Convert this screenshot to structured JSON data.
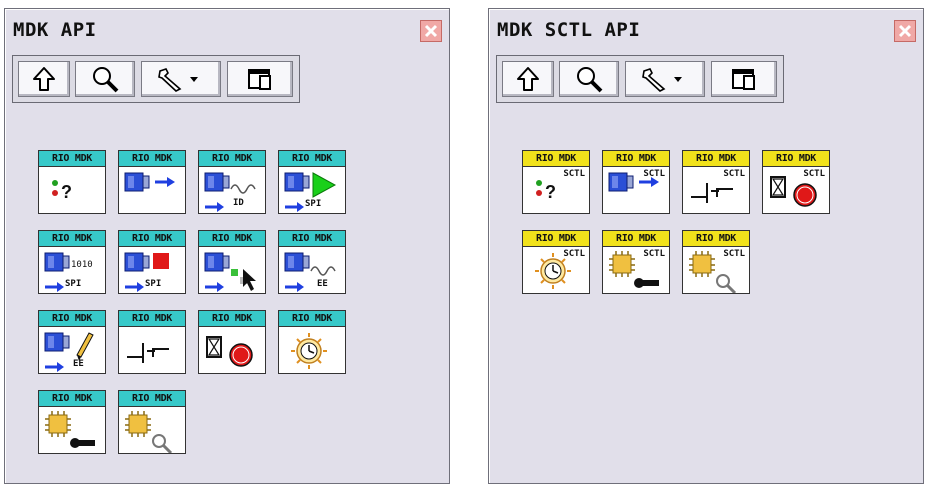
{
  "palettes": [
    {
      "title": "MDK API",
      "icons": [
        {
          "header": "RIO MDK",
          "header_color": "cyan",
          "glyph": "query-icon",
          "sub": ""
        },
        {
          "header": "RIO MDK",
          "header_color": "cyan",
          "glyph": "open-icon",
          "sub": ""
        },
        {
          "header": "RIO MDK",
          "header_color": "cyan",
          "glyph": "read-id-icon",
          "sub": "ID"
        },
        {
          "header": "RIO MDK",
          "header_color": "cyan",
          "glyph": "spi-run-icon",
          "sub": "SPI"
        },
        {
          "header": "RIO MDK",
          "header_color": "cyan",
          "glyph": "spi-data-icon",
          "sub": "SPI"
        },
        {
          "header": "RIO MDK",
          "header_color": "cyan",
          "glyph": "spi-stop-icon",
          "sub": "SPI"
        },
        {
          "header": "RIO MDK",
          "header_color": "cyan",
          "glyph": "select-icon",
          "sub": ""
        },
        {
          "header": "RIO MDK",
          "header_color": "cyan",
          "glyph": "ee-wave-icon",
          "sub": "EE"
        },
        {
          "header": "RIO MDK",
          "header_color": "cyan",
          "glyph": "ee-write-icon",
          "sub": "EE"
        },
        {
          "header": "RIO MDK",
          "header_color": "cyan",
          "glyph": "step-icon",
          "sub": ""
        },
        {
          "header": "RIO MDK",
          "header_color": "cyan",
          "glyph": "hourglass-stop-icon",
          "sub": ""
        },
        {
          "header": "RIO MDK",
          "header_color": "cyan",
          "glyph": "sun-clock-icon",
          "sub": ""
        },
        {
          "header": "RIO MDK",
          "header_color": "cyan",
          "glyph": "chip-key-icon",
          "sub": ""
        },
        {
          "header": "RIO MDK",
          "header_color": "cyan",
          "glyph": "chip-search-icon",
          "sub": ""
        }
      ]
    },
    {
      "title": "MDK SCTL API",
      "icons": [
        {
          "header": "RIO MDK",
          "header_color": "yellow",
          "glyph": "query-icon",
          "sub": "SCTL"
        },
        {
          "header": "RIO MDK",
          "header_color": "yellow",
          "glyph": "open-icon",
          "sub": "SCTL"
        },
        {
          "header": "RIO MDK",
          "header_color": "yellow",
          "glyph": "step-icon",
          "sub": "SCTL"
        },
        {
          "header": "RIO MDK",
          "header_color": "yellow",
          "glyph": "hourglass-stop-icon",
          "sub": "SCTL"
        },
        {
          "header": "RIO MDK",
          "header_color": "yellow",
          "glyph": "sun-clock-icon",
          "sub": "SCTL"
        },
        {
          "header": "RIO MDK",
          "header_color": "yellow",
          "glyph": "chip-key-icon",
          "sub": "SCTL"
        },
        {
          "header": "RIO MDK",
          "header_color": "yellow",
          "glyph": "chip-search-icon",
          "sub": "SCTL"
        }
      ]
    }
  ],
  "toolbar": {
    "buttons": [
      "up-arrow-icon",
      "search-icon",
      "wrench-dropdown-icon",
      "window-icon"
    ]
  },
  "colors": {
    "window_bg": "#e1dfea",
    "header_cyan": "#37c9c9",
    "header_yellow": "#f1e21b",
    "close_button": "#f0a8a6"
  }
}
